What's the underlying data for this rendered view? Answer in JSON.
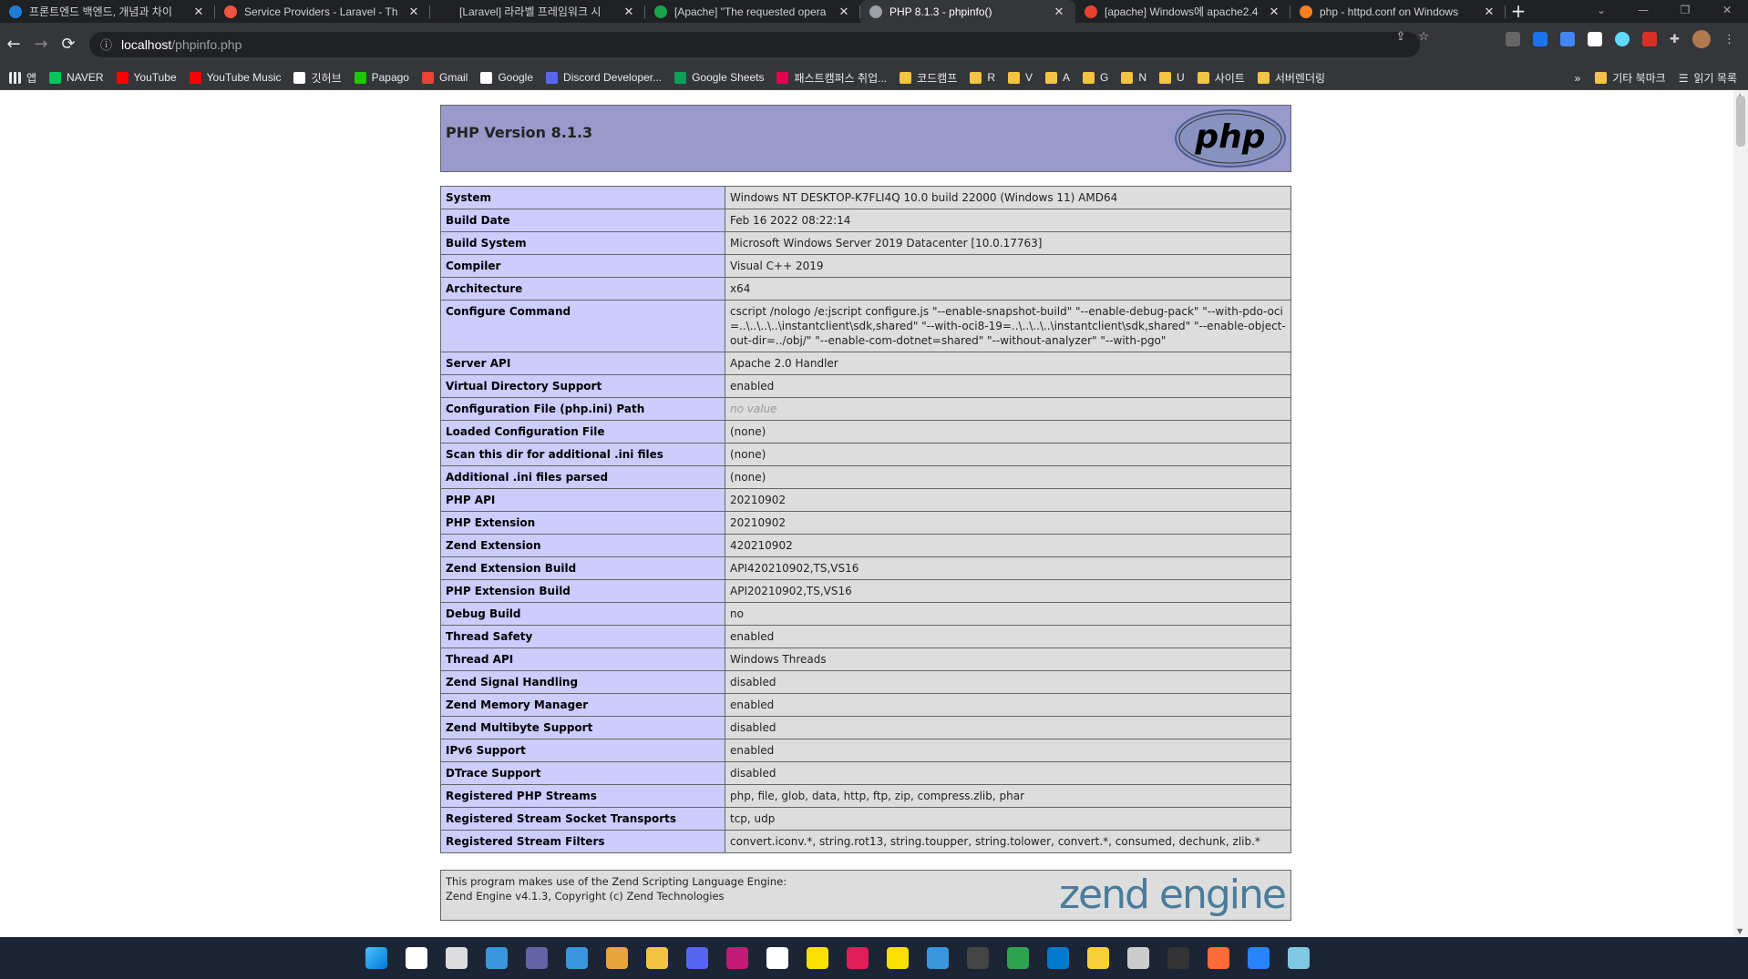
{
  "browser": {
    "tabs": [
      {
        "label": "프론트엔드 백엔드, 개념과 차이",
        "icon": "site-favicon",
        "color": "#1c7ed6"
      },
      {
        "label": "Service Providers - Laravel - Th",
        "icon": "laravel-icon",
        "color": "#f05340"
      },
      {
        "label": "[Laravel] 라라벨 프레임워크 시",
        "icon": "velog-icon",
        "color": "#202124"
      },
      {
        "label": "[Apache] \"The requested opera",
        "icon": "chat-icon",
        "color": "#18a34a"
      },
      {
        "label": "PHP 8.1.3 - phpinfo()",
        "icon": "globe-icon",
        "color": "#9aa0a6",
        "active": true
      },
      {
        "label": "[apache] Windows에 apache2.4",
        "icon": "code-icon",
        "color": "#e8432e"
      },
      {
        "label": "php - httpd.conf on Windows",
        "icon": "stackoverflow-icon",
        "color": "#f48024"
      }
    ],
    "new_tab": "+",
    "url_host": "localhost",
    "url_path": "/phpinfo.php",
    "bookmarks": [
      {
        "label": "앱",
        "type": "apps"
      },
      {
        "label": "NAVER",
        "color": "#03c75a"
      },
      {
        "label": "YouTube",
        "color": "#ff0000"
      },
      {
        "label": "YouTube Music",
        "color": "#ff0000"
      },
      {
        "label": "깃허브",
        "color": "#ffffff"
      },
      {
        "label": "Papago",
        "color": "#1ec800"
      },
      {
        "label": "Gmail",
        "color": "#ea4335"
      },
      {
        "label": "Google",
        "color": "#ffffff"
      },
      {
        "label": "Discord Developer...",
        "color": "#5865f2"
      },
      {
        "label": "Google Sheets",
        "color": "#0f9d58"
      },
      {
        "label": "패스트캠퍼스 취업...",
        "color": "#e5004f"
      },
      {
        "label": "코드캠프",
        "type": "folder"
      },
      {
        "label": "R",
        "type": "folder"
      },
      {
        "label": "V",
        "type": "folder"
      },
      {
        "label": "A",
        "type": "folder"
      },
      {
        "label": "G",
        "type": "folder"
      },
      {
        "label": "N",
        "type": "folder"
      },
      {
        "label": "U",
        "type": "folder"
      },
      {
        "label": "사이트",
        "type": "folder"
      },
      {
        "label": "서버렌더링",
        "type": "folder"
      }
    ],
    "bookmarks_more": "»",
    "other_bookmarks": "기타 북마크",
    "reading_list": "읽기 목록"
  },
  "page": {
    "title": "PHP Version 8.1.3",
    "logo_text": "php",
    "rows": [
      {
        "key": "System",
        "value": "Windows NT DESKTOP-K7FLI4Q 10.0 build 22000 (Windows 11) AMD64"
      },
      {
        "key": "Build Date",
        "value": "Feb 16 2022 08:22:14"
      },
      {
        "key": "Build System",
        "value": "Microsoft Windows Server 2019 Datacenter [10.0.17763]"
      },
      {
        "key": "Compiler",
        "value": "Visual C++ 2019"
      },
      {
        "key": "Architecture",
        "value": "x64"
      },
      {
        "key": "Configure Command",
        "value": "cscript /nologo /e:jscript configure.js \"--enable-snapshot-build\" \"--enable-debug-pack\" \"--with-pdo-oci=..\\..\\..\\..\\instantclient\\sdk,shared\" \"--with-oci8-19=..\\..\\..\\..\\instantclient\\sdk,shared\" \"--enable-object-out-dir=../obj/\" \"--enable-com-dotnet=shared\" \"--without-analyzer\" \"--with-pgo\""
      },
      {
        "key": "Server API",
        "value": "Apache 2.0 Handler"
      },
      {
        "key": "Virtual Directory Support",
        "value": "enabled"
      },
      {
        "key": "Configuration File (php.ini) Path",
        "value": "no value",
        "novalue": true
      },
      {
        "key": "Loaded Configuration File",
        "value": "(none)"
      },
      {
        "key": "Scan this dir for additional .ini files",
        "value": "(none)"
      },
      {
        "key": "Additional .ini files parsed",
        "value": "(none)"
      },
      {
        "key": "PHP API",
        "value": "20210902"
      },
      {
        "key": "PHP Extension",
        "value": "20210902"
      },
      {
        "key": "Zend Extension",
        "value": "420210902"
      },
      {
        "key": "Zend Extension Build",
        "value": "API420210902,TS,VS16"
      },
      {
        "key": "PHP Extension Build",
        "value": "API20210902,TS,VS16"
      },
      {
        "key": "Debug Build",
        "value": "no"
      },
      {
        "key": "Thread Safety",
        "value": "enabled"
      },
      {
        "key": "Thread API",
        "value": "Windows Threads"
      },
      {
        "key": "Zend Signal Handling",
        "value": "disabled"
      },
      {
        "key": "Zend Memory Manager",
        "value": "enabled"
      },
      {
        "key": "Zend Multibyte Support",
        "value": "disabled"
      },
      {
        "key": "IPv6 Support",
        "value": "enabled"
      },
      {
        "key": "DTrace Support",
        "value": "disabled"
      },
      {
        "key": "Registered PHP Streams",
        "value": "php, file, glob, data, http, ftp, zip, compress.zlib, phar"
      },
      {
        "key": "Registered Stream Socket Transports",
        "value": "tcp, udp"
      },
      {
        "key": "Registered Stream Filters",
        "value": "convert.iconv.*, string.rot13, string.toupper, string.tolower, convert.*, consumed, dechunk, zlib.*"
      }
    ],
    "zend_line1": "This program makes use of the Zend Scripting Language Engine:",
    "zend_line2": "Zend Engine v4.1.3, Copyright (c) Zend Technologies",
    "zend_logo_text": "zend engine"
  },
  "taskbar": {
    "icons": [
      "start-icon",
      "search-icon",
      "task-view-icon",
      "widgets-icon",
      "teams-chat-icon",
      "mail-icon",
      "chrome-icon",
      "file-explorer-icon",
      "discord-icon",
      "jetbrains-icon",
      "notion-icon",
      "kakao-icon",
      "slack-icon",
      "kakaotalk-icon",
      "notepad-icon",
      "terminal-icon",
      "checklist-icon",
      "vscode-icon",
      "sticky-notes-icon",
      "sandbox-icon",
      "cmd-icon",
      "postman-icon",
      "sourcetree-icon",
      "photos-icon"
    ]
  }
}
